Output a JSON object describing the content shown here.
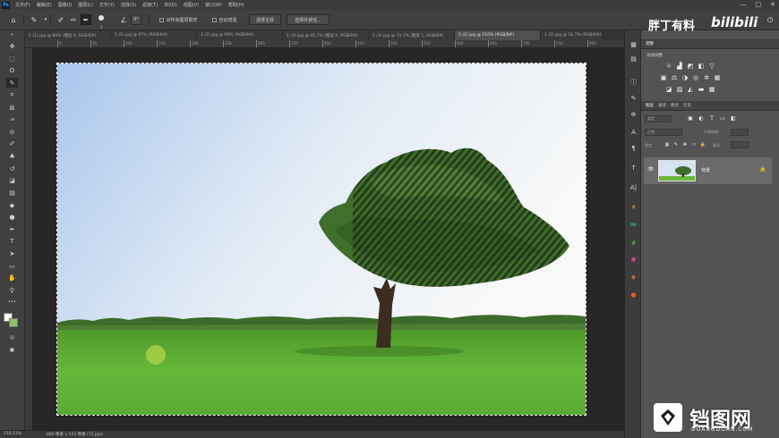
{
  "menu": {
    "ps_logo": "Ps",
    "items": [
      "文件(F)",
      "编辑(E)",
      "图像(I)",
      "图层(L)",
      "文字(Y)",
      "选择(S)",
      "滤镜(T)",
      "3D(D)",
      "视图(V)",
      "窗口(W)",
      "帮助(H)"
    ],
    "window_controls": [
      "—",
      "□",
      "✕"
    ]
  },
  "options": {
    "brush_size": "1",
    "sample_all_layers": "对所有图层取样",
    "auto_enhance": "自动增强",
    "select_subject": "选择主体",
    "select_and_mask": "选择并遮住..."
  },
  "tabs": [
    {
      "label": "1 (1).jpg @ 80% (图层 0, RGB/8#)",
      "active": false
    },
    {
      "label": "1 (1).jpg @ 67% (RGB/8#)",
      "active": false
    },
    {
      "label": "1 (2).jpg @ 99% (RGB/8#)",
      "active": false
    },
    {
      "label": "1 (3).jpg @ 45.7% (图层 0, RGB/8#)",
      "active": false
    },
    {
      "label": "1 (3).jpg @ 73.1% (图层 1, RGB/8#)",
      "active": false
    },
    {
      "label": "5 (2).jpg @ 216% (RGB/8#)",
      "active": true
    },
    {
      "label": "1 (3).jpg @ 16.7% (RGB/8#)",
      "active": false
    }
  ],
  "ruler_top_labels": [
    "0",
    "50",
    "100",
    "150",
    "200",
    "250",
    "300",
    "350",
    "400",
    "450",
    "500",
    "550",
    "600",
    "650",
    "700",
    "750",
    "800"
  ],
  "status": {
    "zoom": "216.23%",
    "doc_info": "889 像素 x 533 像素 (72 ppi)"
  },
  "panels": {
    "watermark_top": "胖丁有料",
    "watermark_bili": "bilibili",
    "adjustments_tab": "调整",
    "adjustments_title": "添加调整",
    "layer_tabs": [
      {
        "label": "图层",
        "active": true
      },
      {
        "label": "通道",
        "active": false
      },
      {
        "label": "路径",
        "active": false
      },
      {
        "label": "历史",
        "active": false
      }
    ],
    "layer_kind": "类型",
    "blend_mode": "正常",
    "opacity_label": "不透明度:",
    "lock_label": "锁定:",
    "fill_label": "填充:",
    "layer_name": "背景"
  },
  "watermark_bottom": {
    "brand": "铛图网",
    "sub": "DOANGDOAN.COM"
  },
  "colors": {
    "accent": "#31a8ff",
    "panel_bg": "#535353",
    "ui_dark": "#282828"
  }
}
